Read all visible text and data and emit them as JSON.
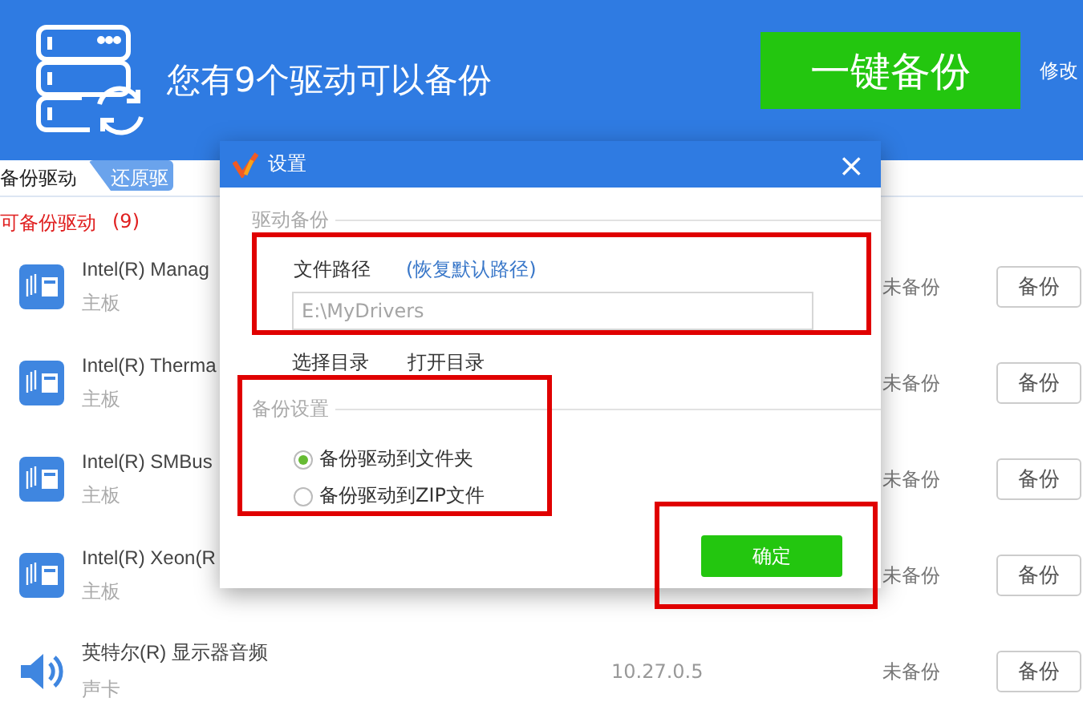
{
  "header": {
    "title": "您有9个驱动可以备份",
    "primary_button": "一键备份",
    "side_link": "修改"
  },
  "tabs": [
    {
      "label": "备份驱动",
      "selected": true
    },
    {
      "label": "还原驱",
      "selected": false
    }
  ],
  "section_title": "可备份驱动",
  "section_count": "(9)",
  "drivers": [
    {
      "kind": "board",
      "name": "Intel(R) Manag",
      "category": "主板",
      "status": "未备份",
      "button": "备份"
    },
    {
      "kind": "board",
      "name": "Intel(R) Therma",
      "category": "主板",
      "status": "未备份",
      "button": "备份"
    },
    {
      "kind": "board",
      "name": "Intel(R) SMBus",
      "category": "主板",
      "status": "未备份",
      "button": "备份"
    },
    {
      "kind": "board",
      "name": "Intel(R) Xeon(R",
      "category": "主板",
      "status": "未备份",
      "button": "备份"
    },
    {
      "kind": "speaker",
      "name": "英特尔(R) 显示器音频",
      "category": "声卡",
      "version": "10.27.0.5",
      "status": "未备份",
      "button": "备份"
    }
  ],
  "dialog": {
    "title": "设置",
    "close": "×",
    "backup_group": {
      "legend": "驱动备份",
      "path_label": "文件路径",
      "restore_link": "(恢复默认路径)",
      "path_value": "E:\\MyDrivers",
      "actions": [
        "选择目录",
        "打开目录"
      ]
    },
    "settings_group": {
      "legend": "备份设置",
      "options": [
        {
          "label": "备份驱动到文件夹",
          "selected": true
        },
        {
          "label": "备份驱动到ZIP文件",
          "selected": false
        }
      ]
    },
    "ok_button": "确定"
  }
}
